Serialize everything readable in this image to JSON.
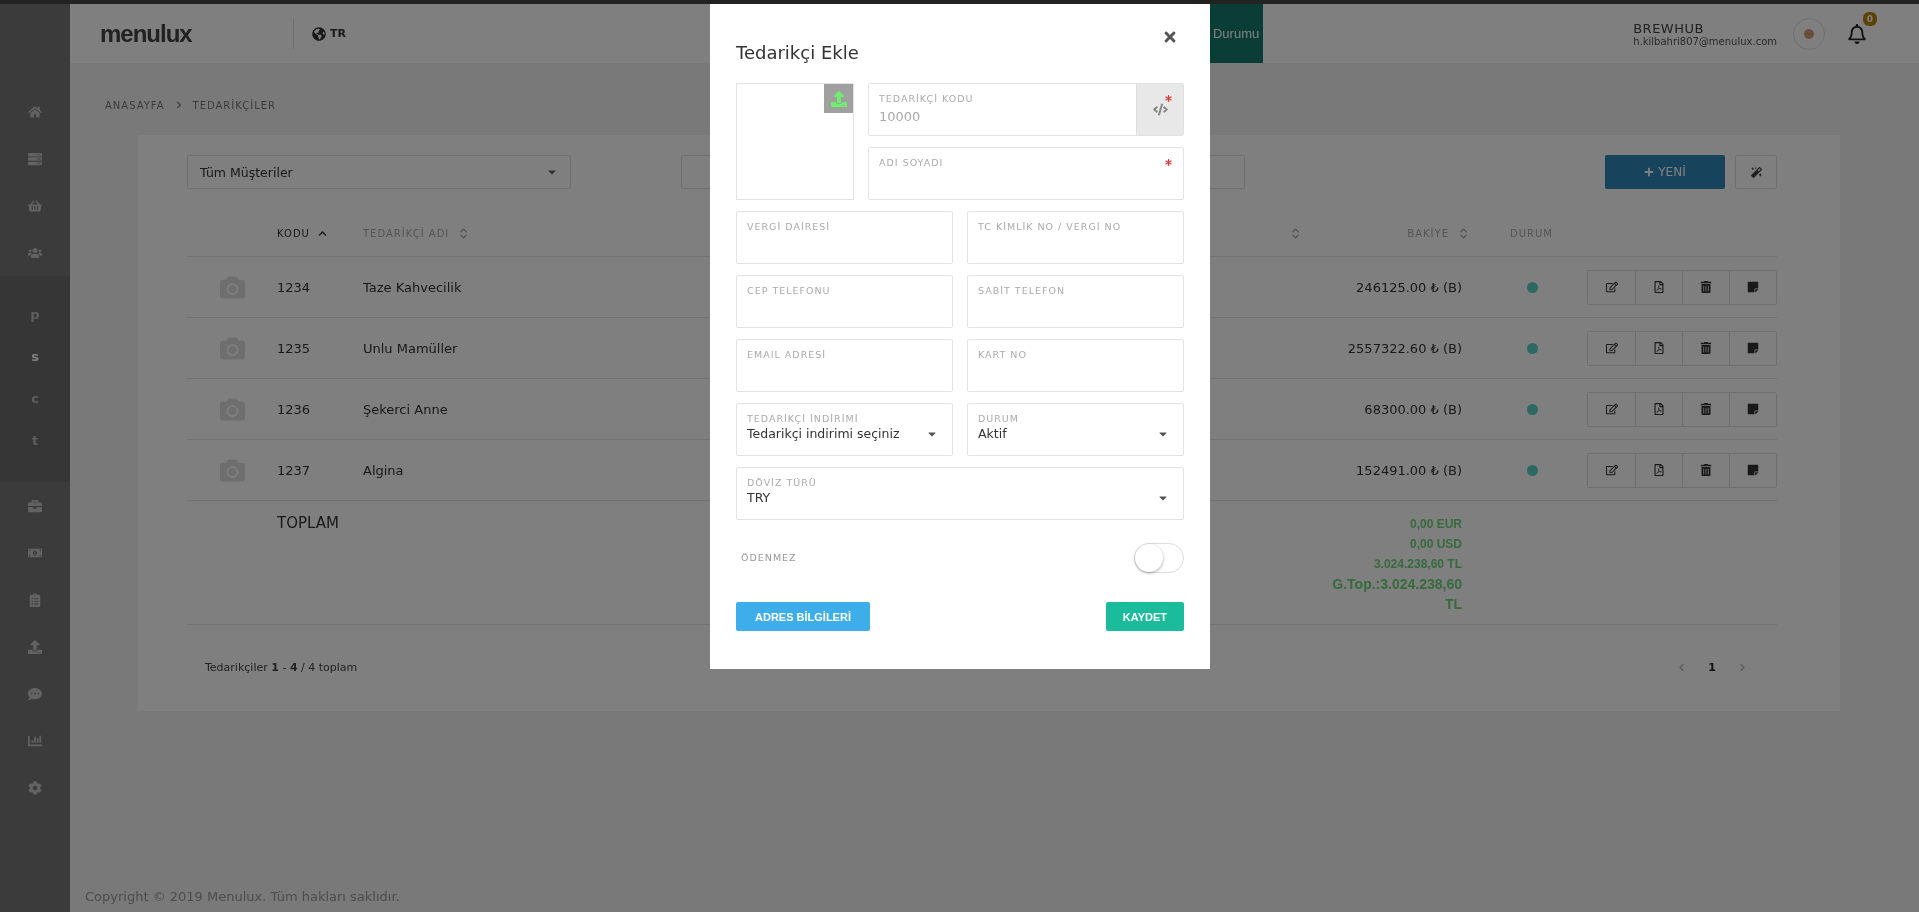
{
  "sidebar": {
    "items": [
      {
        "kind": "icon",
        "selected": false
      },
      {
        "kind": "icon",
        "selected": false
      },
      {
        "kind": "icon",
        "selected": false
      },
      {
        "kind": "icon",
        "selected": false
      },
      {
        "kind": "letter",
        "label": "p",
        "selected": false
      },
      {
        "kind": "letter",
        "label": "s",
        "selected": true
      },
      {
        "kind": "letter",
        "label": "c",
        "selected": false
      },
      {
        "kind": "letter",
        "label": "t",
        "selected": false
      },
      {
        "kind": "icon",
        "selected": false
      },
      {
        "kind": "icon",
        "selected": false
      },
      {
        "kind": "icon",
        "selected": false
      },
      {
        "kind": "icon",
        "selected": false
      },
      {
        "kind": "icon",
        "selected": false
      },
      {
        "kind": "icon",
        "selected": false
      },
      {
        "kind": "icon",
        "selected": false
      }
    ]
  },
  "header": {
    "logo": "menulux",
    "language": "TR",
    "tab": "Durumu",
    "user": {
      "name": "BREWHUB",
      "email": "h.kilbahri807@menulux.com"
    },
    "notifications": "0"
  },
  "breadcrumb": [
    "ANASAYFA",
    "TEDARİKÇİLER"
  ],
  "toolbar": {
    "filter": "Tüm Müşteriler",
    "new_button": "YENİ"
  },
  "table": {
    "columns": [
      {
        "label": "KODU",
        "sortable": true,
        "selected": true
      },
      {
        "label": "TEDARİKÇİ ADI",
        "sortable": true,
        "selected": false
      },
      {
        "sortable": true,
        "selected": false
      },
      {
        "label": "BAKİYE",
        "sortable": true,
        "selected": false
      },
      {
        "label": "DURUM",
        "sortable": false,
        "selected": false
      }
    ],
    "rows": [
      {
        "code": "1234",
        "name": "Taze Kahvecilik",
        "balance": "246125.00 ₺ (B)",
        "active": true
      },
      {
        "code": "1235",
        "name": "Unlu Mamüller",
        "balance": "2557322.60 ₺ (B)",
        "active": true
      },
      {
        "code": "1236",
        "name": "Şekerci Anne",
        "balance": "68300.00 ₺ (B)",
        "active": true
      },
      {
        "code": "1237",
        "name": "Algina",
        "balance": "152491.00 ₺ (B)",
        "active": true
      }
    ],
    "totals": {
      "label": "TOPLAM",
      "lines": [
        "0,00 EUR",
        "0,00 USD",
        "3.024.238,60 TL"
      ],
      "grand": "G.Top.:3.024.238,60 TL"
    },
    "summary": "Tedarikçiler **1** - **4** / 4 toplam",
    "pages": [
      {
        "label": "1",
        "selected": true
      }
    ]
  },
  "copyright": "Copyright © 2019 Menulux. Tüm hakları saklıdır.",
  "modal": {
    "title": "Tedarikçi Ekle",
    "fields": [
      {
        "kind": "code",
        "label": "TEDARİKÇİ KODU",
        "placeholder": "10000",
        "required": true
      },
      {
        "kind": "text",
        "label": "ADI SOYADI",
        "required": true
      },
      {
        "kind": "text",
        "label": "VERGİ DAİRESİ",
        "required": false
      },
      {
        "kind": "text",
        "label": "TC KİMLİK NO / VERGİ NO",
        "required": false
      },
      {
        "kind": "text",
        "label": "CEP TELEFONU",
        "required": false
      },
      {
        "kind": "text",
        "label": "SABİT TELEFON",
        "required": false
      },
      {
        "kind": "text",
        "label": "EMAIL ADRESİ",
        "required": false
      },
      {
        "kind": "text",
        "label": "KART NO",
        "required": false
      },
      {
        "kind": "select",
        "label": "TEDARİKÇİ İNDİRİMİ",
        "value": "Tedarikçi indirimi seçiniz"
      },
      {
        "kind": "select",
        "label": "DURUM",
        "value": "Aktif"
      },
      {
        "kind": "wide_select",
        "label": "DÖVİZ TÜRÜ",
        "value": "TRY"
      }
    ],
    "toggle": {
      "label": "ÖDENMEZ",
      "on": false
    },
    "buttons": [
      {
        "kind": "secondary",
        "label": "ADRES BİLGİLERİ"
      },
      {
        "kind": "primary",
        "label": "KAYDET"
      }
    ]
  }
}
